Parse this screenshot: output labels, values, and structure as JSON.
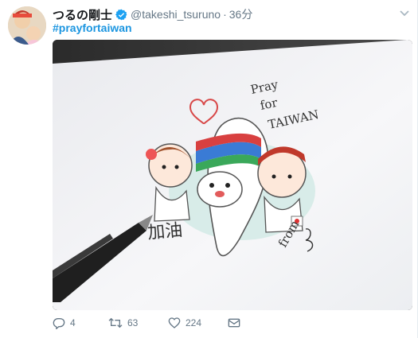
{
  "tweet": {
    "display_name": "つるの剛士",
    "handle": "@takeshi_tsuruno",
    "separator": "·",
    "time": "36分",
    "text": "#prayfortaiwan",
    "drawing": {
      "pray_text_line1": "Pray",
      "pray_text_line2": "for",
      "pray_text_line3": "TAIWAN",
      "signature_left": "加油",
      "signature_right": "from"
    },
    "actions": {
      "reply_count": "4",
      "retweet_count": "63",
      "like_count": "224"
    }
  },
  "colors": {
    "link": "#1b95e0",
    "muted": "#657786",
    "verified": "#1da1f2"
  }
}
